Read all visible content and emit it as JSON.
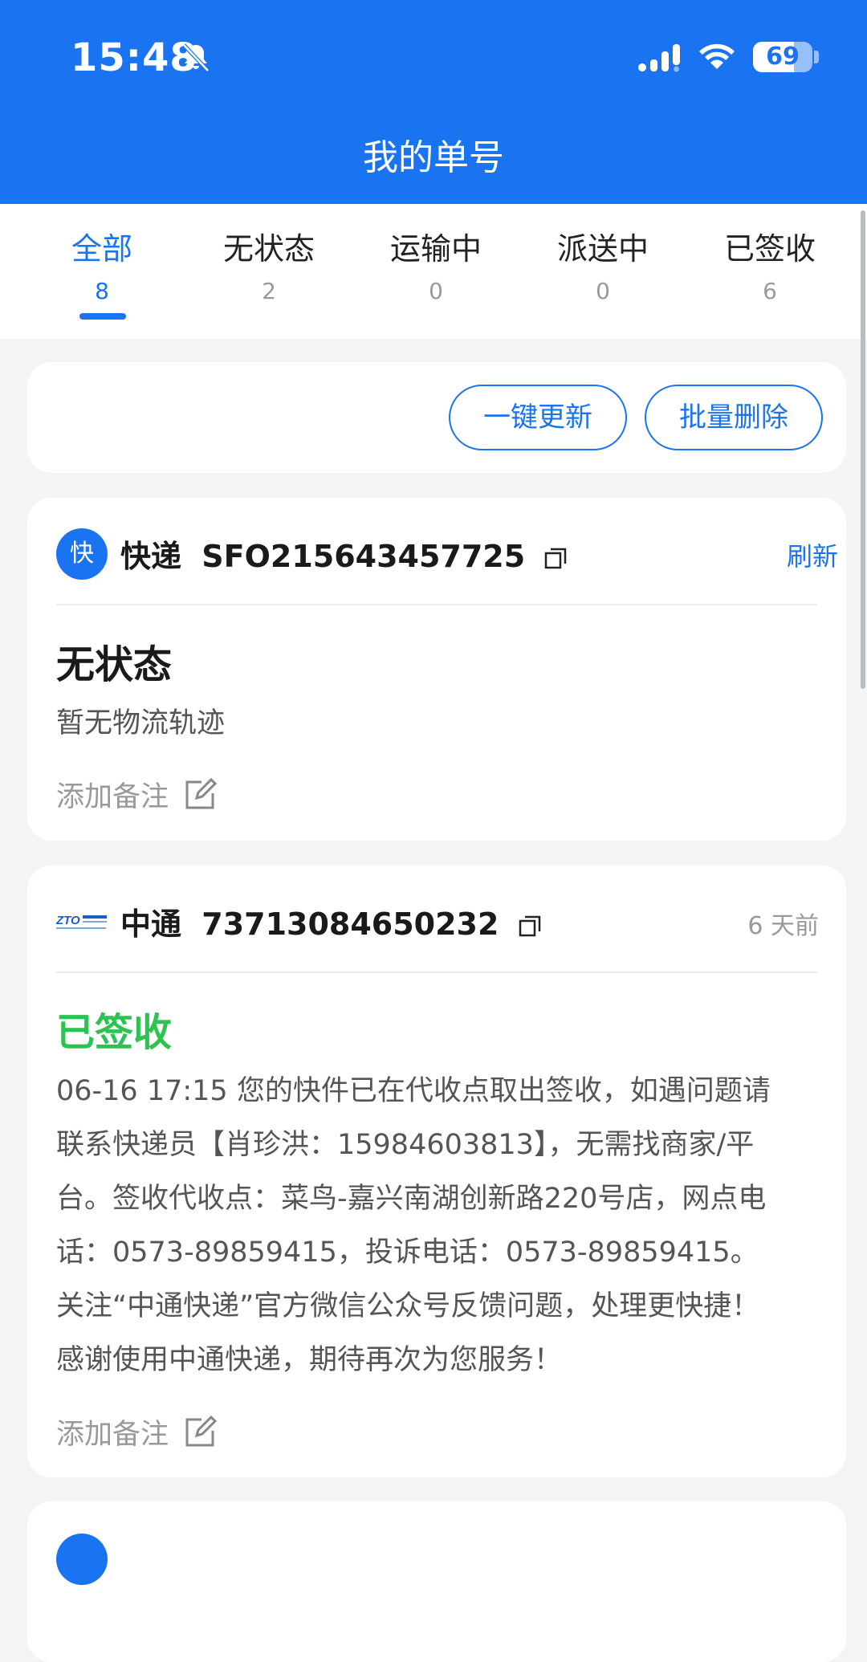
{
  "status_bar": {
    "time": "15:48",
    "battery": "69",
    "battery_level": 0.69,
    "icons": [
      "bell-slash-icon",
      "signal-icon",
      "wifi-icon",
      "battery-icon"
    ]
  },
  "header": {
    "title": "我的单号"
  },
  "tabs": [
    {
      "label": "全部",
      "count": "8",
      "active": true
    },
    {
      "label": "无状态",
      "count": "2"
    },
    {
      "label": "运输中",
      "count": "0"
    },
    {
      "label": "派送中",
      "count": "0"
    },
    {
      "label": "已签收",
      "count": "6"
    }
  ],
  "actions": {
    "update_all": "一键更新",
    "batch_delete": "批量删除"
  },
  "orders": [
    {
      "icon_text": "快",
      "carrier": "快递",
      "number": "SFO215643457725",
      "refresh_label": "刷新",
      "status": "无状态",
      "description": "暂无物流轨迹",
      "note_label": "添加备注"
    },
    {
      "carrier": "中通",
      "number": "73713084650232",
      "time_ago": "6 天前",
      "status": "已签收",
      "description_lines": [
        "06-16 17:15 您的快件已在代收点取出签收，如遇问题请",
        "联系快递员【肖珍洪：15984603813】，无需找商家/平",
        "台。签收代收点：菜鸟-嘉兴南湖创新路220号店，网点电",
        "话：0573-89859415，投诉电话：0573-89859415。",
        "关注“中通快递”官方微信公众号反馈问题，处理更快捷！",
        "感谢使用中通快递，期待再次为您服务！"
      ],
      "note_label": "添加备注"
    }
  ],
  "colors": {
    "primary": "#1a73f0",
    "signed_green": "#2cc350"
  }
}
